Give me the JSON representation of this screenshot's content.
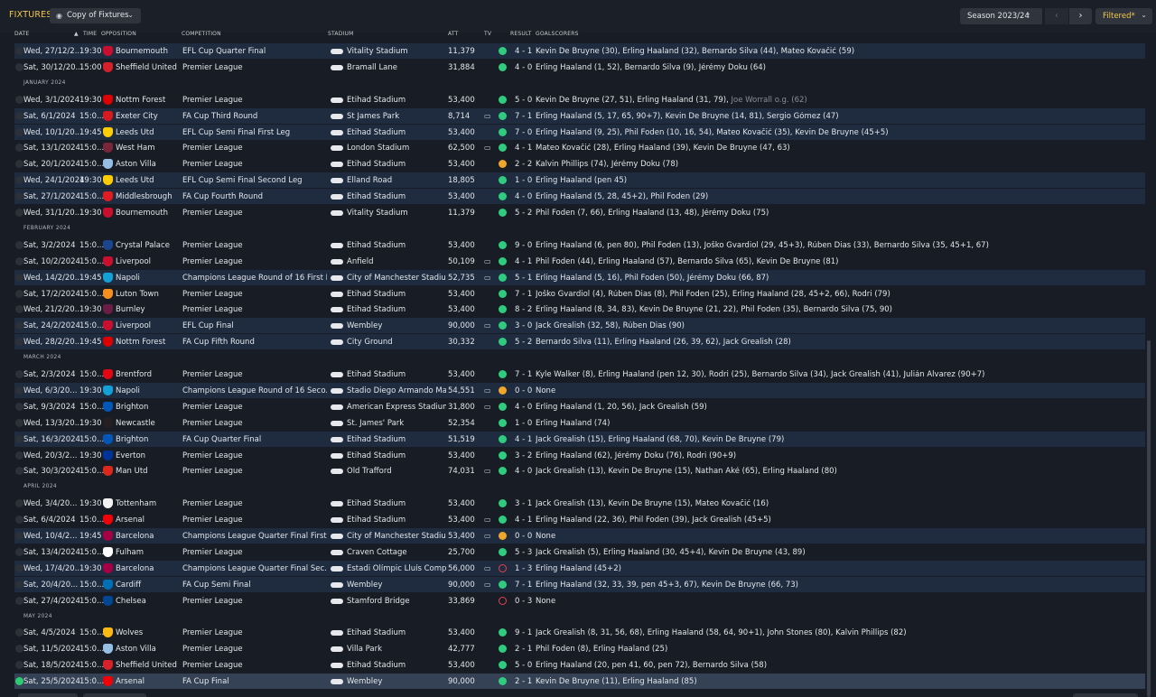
{
  "header": {
    "title": "FIXTURES",
    "view_select": "Copy of Fixtures",
    "season_select": "Season 2023/24",
    "filter_button": "Filtered*"
  },
  "columns": {
    "date": "DATE",
    "time": "TIME",
    "opposition": "OPPOSITION",
    "competition": "COMPETITION",
    "stadium": "STADIUM",
    "att": "ATT",
    "tv": "TV",
    "result": "RESULT",
    "goalscorers": "GOALSCORERS"
  },
  "icons": {
    "view": "eye-icon",
    "chevron": "chevron-down-icon",
    "prev": "chevron-left-icon",
    "next": "chevron-right-icon",
    "stadium": "stadium-icon",
    "tv": "tv-icon",
    "sort": "sort-ascending-icon"
  },
  "colors": {
    "accent": "#f2c94c",
    "win": "#2fcb7f",
    "draw": "#f0a52b",
    "loss": "#e4414f",
    "row_highlight": "#1f2c40"
  },
  "rows": [
    {
      "kind": "m",
      "date": "Wed, 27/12/2...",
      "time": "19:30",
      "opp": "Bournemouth",
      "comp": "EFL Cup Quarter Final",
      "stad": "Vitality Stadium",
      "att": "11,379",
      "tv": false,
      "res": "W",
      "score": "4 - 1",
      "goals": "Kevin De Bruyne (30), Erling Haaland (32), Bernardo Silva (44), Mateo Kovačić (59)",
      "badge": "#c8102e",
      "hl": true
    },
    {
      "kind": "m",
      "date": "Sat, 30/12/20...",
      "time": "15:00",
      "opp": "Sheffield United",
      "comp": "Premier League",
      "stad": "Bramall Lane",
      "att": "31,884",
      "tv": false,
      "res": "W",
      "score": "4 - 0",
      "goals": "Erling Haaland (1, 52), Bernardo Silva (9), Jérémy Doku (64)",
      "badge": "#d6212b",
      "hl": false
    },
    {
      "kind": "h",
      "label": "JANUARY 2024"
    },
    {
      "kind": "m",
      "date": "Wed, 3/1/2024",
      "time": "19:30",
      "opp": "Nottm Forest",
      "comp": "Premier League",
      "stad": "Etihad Stadium",
      "att": "53,400",
      "tv": false,
      "res": "W",
      "score": "5 - 0",
      "goals": "Kevin De Bruyne (27, 51), Erling Haaland (31, 79), ",
      "og": "Joe Worrall o.g. (62)",
      "badge": "#dd0000",
      "hl": false
    },
    {
      "kind": "m",
      "date": "Sat, 6/1/2024",
      "time": "15:0...",
      "opp": "Exeter City",
      "comp": "FA Cup Third Round",
      "stad": "St James Park",
      "att": "8,714",
      "tv": true,
      "res": "W",
      "score": "7 - 1",
      "goals": "Erling Haaland (5, 17, 65, 90+7), Kevin De Bruyne (14, 81), Sergio Gómez (47)",
      "badge": "#d71920",
      "hl": true
    },
    {
      "kind": "m",
      "date": "Wed, 10/1/20...",
      "time": "19:45",
      "opp": "Leeds Utd",
      "comp": "EFL Cup Semi Final First Leg",
      "stad": "Etihad Stadium",
      "att": "53,400",
      "tv": false,
      "res": "W",
      "score": "7 - 0",
      "goals": "Erling Haaland (9, 25), Phil Foden (10, 16, 54), Mateo Kovačić (35), Kevin De Bruyne (45+5)",
      "badge": "#ffcd00",
      "hl": true
    },
    {
      "kind": "m",
      "date": "Sat, 13/1/2024",
      "time": "15:0...",
      "opp": "West Ham",
      "comp": "Premier League",
      "stad": "London Stadium",
      "att": "62,500",
      "tv": true,
      "res": "W",
      "score": "4 - 1",
      "goals": "Mateo Kovačić (28), Erling Haaland (39), Kevin De Bruyne (47, 63)",
      "badge": "#7a263a",
      "hl": false
    },
    {
      "kind": "m",
      "date": "Sat, 20/1/2024",
      "time": "15:0...",
      "opp": "Aston Villa",
      "comp": "Premier League",
      "stad": "Etihad Stadium",
      "att": "53,400",
      "tv": false,
      "res": "D",
      "score": "2 - 2",
      "goals": "Kalvin Phillips (74), Jérémy Doku (78)",
      "badge": "#95bfe5",
      "hl": false
    },
    {
      "kind": "m",
      "date": "Wed, 24/1/2024",
      "time": "19:30",
      "opp": "Leeds Utd",
      "comp": "EFL Cup Semi Final Second Leg",
      "stad": "Elland Road",
      "att": "18,805",
      "tv": false,
      "res": "W",
      "score": "1 - 0",
      "goals": "Erling Haaland (pen 45)",
      "badge": "#ffcd00",
      "hl": true
    },
    {
      "kind": "m",
      "date": "Sat, 27/1/2024",
      "time": "15:0...",
      "opp": "Middlesbrough",
      "comp": "FA Cup Fourth Round",
      "stad": "Etihad Stadium",
      "att": "53,400",
      "tv": false,
      "res": "W",
      "score": "4 - 0",
      "goals": "Erling Haaland (5, 28, 45+2), Phil Foden (29)",
      "badge": "#e11b22",
      "hl": true
    },
    {
      "kind": "m",
      "date": "Wed, 31/1/20...",
      "time": "19:30",
      "opp": "Bournemouth",
      "comp": "Premier League",
      "stad": "Vitality Stadium",
      "att": "11,379",
      "tv": false,
      "res": "W",
      "score": "5 - 2",
      "goals": "Phil Foden (7, 66), Erling Haaland (13, 48), Jérémy Doku (75)",
      "badge": "#c8102e",
      "hl": false
    },
    {
      "kind": "h",
      "label": "FEBRUARY 2024"
    },
    {
      "kind": "m",
      "date": "Sat, 3/2/2024",
      "time": "15:0...",
      "opp": "Crystal Palace",
      "comp": "Premier League",
      "stad": "Etihad Stadium",
      "att": "53,400",
      "tv": false,
      "res": "W",
      "score": "9 - 0",
      "goals": "Erling Haaland (6, pen 80), Phil Foden (13), Joško Gvardiol (29, 45+3), Rúben Dias (33), Bernardo Silva (35, 45+1, 67)",
      "badge": "#1b458f",
      "hl": false
    },
    {
      "kind": "m",
      "date": "Sat, 10/2/2024",
      "time": "15:0...",
      "opp": "Liverpool",
      "comp": "Premier League",
      "stad": "Anfield",
      "att": "50,109",
      "tv": true,
      "res": "W",
      "score": "4 - 1",
      "goals": "Phil Foden (44), Erling Haaland (57), Bernardo Silva (65), Kevin De Bruyne (81)",
      "badge": "#c8102e",
      "hl": false
    },
    {
      "kind": "m",
      "date": "Wed, 14/2/20...",
      "time": "19:45",
      "opp": "Napoli",
      "comp": "Champions League Round of 16  First L...",
      "stad": "City of Manchester Stadiu...",
      "att": "52,735",
      "tv": true,
      "res": "W",
      "score": "5 - 1",
      "goals": "Erling Haaland (5, 16), Phil Foden (50), Jérémy Doku (66, 87)",
      "badge": "#12a0d7",
      "hl": true
    },
    {
      "kind": "m",
      "date": "Sat, 17/2/2024",
      "time": "15:0...",
      "opp": "Luton Town",
      "comp": "Premier League",
      "stad": "Etihad Stadium",
      "att": "53,400",
      "tv": false,
      "res": "W",
      "score": "7 - 1",
      "goals": "Joško Gvardiol (4), Rúben Dias (8), Phil Foden (25), Erling Haaland (28, 45+2, 66), Rodri (79)",
      "badge": "#f78f1e",
      "hl": false
    },
    {
      "kind": "m",
      "date": "Wed, 21/2/20...",
      "time": "19:30",
      "opp": "Burnley",
      "comp": "Premier League",
      "stad": "Etihad Stadium",
      "att": "53,400",
      "tv": false,
      "res": "W",
      "score": "8 - 2",
      "goals": "Erling Haaland (8, 34, 83), Kevin De Bruyne (21, 22), Phil Foden (35), Bernardo Silva (75, 90)",
      "badge": "#6c1d45",
      "hl": false
    },
    {
      "kind": "m",
      "date": "Sat, 24/2/2024",
      "time": "15:0...",
      "opp": "Liverpool",
      "comp": "EFL Cup Final",
      "stad": "Wembley",
      "att": "90,000",
      "tv": true,
      "res": "W",
      "score": "3 - 0",
      "goals": "Jack Grealish (32, 58), Rúben Dias (90)",
      "badge": "#c8102e",
      "hl": true
    },
    {
      "kind": "m",
      "date": "Wed, 28/2/20...",
      "time": "19:45",
      "opp": "Nottm Forest",
      "comp": "FA Cup Fifth Round",
      "stad": "City Ground",
      "att": "30,332",
      "tv": false,
      "res": "W",
      "score": "5 - 2",
      "goals": "Bernardo Silva (11), Erling Haaland (26, 39, 62), Jack Grealish (28)",
      "badge": "#dd0000",
      "hl": true
    },
    {
      "kind": "h",
      "label": "MARCH 2024"
    },
    {
      "kind": "m",
      "date": "Sat, 2/3/2024",
      "time": "15:0...",
      "opp": "Brentford",
      "comp": "Premier League",
      "stad": "Etihad Stadium",
      "att": "53,400",
      "tv": false,
      "res": "W",
      "score": "7 - 1",
      "goals": "Kyle Walker (8), Erling Haaland (pen 12, 30), Rodri (25), Bernardo Silva (34), Jack Grealish (41), Julián Álvarez (90+7)",
      "badge": "#e30613",
      "hl": false
    },
    {
      "kind": "m",
      "date": "Wed, 6/3/20...",
      "time": "19:30",
      "opp": "Napoli",
      "comp": "Champions League Round of 16  Seco...",
      "stad": "Stadio Diego Armando Ma...",
      "att": "54,551",
      "tv": true,
      "res": "D",
      "score": "0 - 0",
      "goals": "None",
      "badge": "#12a0d7",
      "hl": true
    },
    {
      "kind": "m",
      "date": "Sat, 9/3/2024",
      "time": "15:0...",
      "opp": "Brighton",
      "comp": "Premier League",
      "stad": "American Express Stadium",
      "att": "31,800",
      "tv": true,
      "res": "W",
      "score": "4 - 0",
      "goals": "Erling Haaland (1, 20, 56), Jack Grealish (59)",
      "badge": "#0057b8",
      "hl": false
    },
    {
      "kind": "m",
      "date": "Wed, 13/3/20...",
      "time": "19:30",
      "opp": "Newcastle",
      "comp": "Premier League",
      "stad": "St. James' Park",
      "att": "52,354",
      "tv": false,
      "res": "W",
      "score": "1 - 0",
      "goals": "Erling Haaland (74)",
      "badge": "#241f20",
      "hl": false
    },
    {
      "kind": "m",
      "date": "Sat, 16/3/2024",
      "time": "15:0...",
      "opp": "Brighton",
      "comp": "FA Cup Quarter Final",
      "stad": "Etihad Stadium",
      "att": "51,519",
      "tv": false,
      "res": "W",
      "score": "4 - 1",
      "goals": "Jack Grealish (15), Erling Haaland (68, 70), Kevin De Bruyne (79)",
      "badge": "#0057b8",
      "hl": true
    },
    {
      "kind": "m",
      "date": "Wed, 20/3/2...",
      "time": "19:30",
      "opp": "Everton",
      "comp": "Premier League",
      "stad": "Etihad Stadium",
      "att": "53,400",
      "tv": false,
      "res": "W",
      "score": "3 - 2",
      "goals": "Erling Haaland (62), Jérémy Doku (76), Rodri (90+9)",
      "badge": "#003399",
      "hl": false
    },
    {
      "kind": "m",
      "date": "Sat, 30/3/2024",
      "time": "15:0...",
      "opp": "Man Utd",
      "comp": "Premier League",
      "stad": "Old Trafford",
      "att": "74,031",
      "tv": true,
      "res": "W",
      "score": "4 - 0",
      "goals": "Jack Grealish (13), Kevin De Bruyne (15), Nathan Aké (65), Erling Haaland (80)",
      "badge": "#da291c",
      "hl": false
    },
    {
      "kind": "h",
      "label": "APRIL 2024"
    },
    {
      "kind": "m",
      "date": "Wed, 3/4/20...",
      "time": "19:30",
      "opp": "Tottenham",
      "comp": "Premier League",
      "stad": "Etihad Stadium",
      "att": "53,400",
      "tv": false,
      "res": "W",
      "score": "3 - 1",
      "goals": "Jack Grealish (13), Kevin De Bruyne (15), Mateo Kovačić (16)",
      "badge": "#f2f2f2",
      "hl": false
    },
    {
      "kind": "m",
      "date": "Sat, 6/4/2024",
      "time": "15:0...",
      "opp": "Arsenal",
      "comp": "Premier League",
      "stad": "Etihad Stadium",
      "att": "53,400",
      "tv": true,
      "res": "W",
      "score": "4 - 1",
      "goals": "Erling Haaland (22, 36), Phil Foden (39), Jack Grealish (45+5)",
      "badge": "#ef0107",
      "hl": false
    },
    {
      "kind": "m",
      "date": "Wed, 10/4/2...",
      "time": "19:45",
      "opp": "Barcelona",
      "comp": "Champions League Quarter Final First...",
      "stad": "City of Manchester Stadiu...",
      "att": "53,400",
      "tv": true,
      "res": "D",
      "score": "0 - 0",
      "goals": "None",
      "badge": "#a50044",
      "hl": true
    },
    {
      "kind": "m",
      "date": "Sat, 13/4/2024",
      "time": "15:0...",
      "opp": "Fulham",
      "comp": "Premier League",
      "stad": "Craven Cottage",
      "att": "25,700",
      "tv": false,
      "res": "W",
      "score": "5 - 3",
      "goals": "Jack Grealish (5), Erling Haaland (30, 45+4), Kevin De Bruyne (43, 89)",
      "badge": "#ffffff",
      "hl": false
    },
    {
      "kind": "m",
      "date": "Wed, 17/4/20...",
      "time": "19:30",
      "opp": "Barcelona",
      "comp": "Champions League Quarter Final Sec...",
      "stad": "Estadi Olímpic Lluís Comp...",
      "att": "56,000",
      "tv": true,
      "res": "L",
      "score": "1 - 3",
      "goals": "Erling Haaland (45+2)",
      "badge": "#a50044",
      "hl": true
    },
    {
      "kind": "m",
      "date": "Sat, 20/4/20...",
      "time": "15:0...",
      "opp": "Cardiff",
      "comp": "FA Cup Semi Final",
      "stad": "Wembley",
      "att": "90,000",
      "tv": true,
      "res": "W",
      "score": "7 - 1",
      "goals": "Erling Haaland (32, 33, 39, pen 45+3, 67), Kevin De Bruyne (66, 73)",
      "badge": "#0070b5",
      "hl": true
    },
    {
      "kind": "m",
      "date": "Sat, 27/4/2024",
      "time": "15:0...",
      "opp": "Chelsea",
      "comp": "Premier League",
      "stad": "Stamford Bridge",
      "att": "33,869",
      "tv": false,
      "res": "L",
      "score": "0 - 3",
      "goals": "None",
      "badge": "#034694",
      "hl": false
    },
    {
      "kind": "h",
      "label": "MAY 2024"
    },
    {
      "kind": "m",
      "date": "Sat, 4/5/2024",
      "time": "15:0...",
      "opp": "Wolves",
      "comp": "Premier League",
      "stad": "Etihad Stadium",
      "att": "53,400",
      "tv": false,
      "res": "W",
      "score": "9 - 1",
      "goals": "Jack Grealish (8, 31, 56, 68), Erling Haaland (58, 64, 90+1), John Stones (80), Kalvin Phillips (82)",
      "badge": "#fdb913",
      "hl": false
    },
    {
      "kind": "m",
      "date": "Sat, 11/5/2024",
      "time": "15:0...",
      "opp": "Aston Villa",
      "comp": "Premier League",
      "stad": "Villa Park",
      "att": "42,777",
      "tv": false,
      "res": "W",
      "score": "2 - 1",
      "goals": "Phil Foden (8), Erling Haaland (25)",
      "badge": "#95bfe5",
      "hl": false
    },
    {
      "kind": "m",
      "date": "Sat, 18/5/2024",
      "time": "15:0...",
      "opp": "Sheffield United",
      "comp": "Premier League",
      "stad": "Etihad Stadium",
      "att": "53,400",
      "tv": false,
      "res": "W",
      "score": "5 - 0",
      "goals": "Erling Haaland (20, pen 41, 60, pen 72), Bernardo Silva (58)",
      "badge": "#d6212b",
      "hl": false
    },
    {
      "kind": "m",
      "date": "Sat, 25/5/2024",
      "time": "15:0...",
      "opp": "Arsenal",
      "comp": "FA Cup Final",
      "stad": "Wembley",
      "att": "90,000",
      "tv": false,
      "res": "W",
      "score": "2 - 1",
      "goals": "Kevin De Bruyne (11), Erling Haaland (85)",
      "badge": "#ef0107",
      "hl": false,
      "sel": true
    }
  ]
}
